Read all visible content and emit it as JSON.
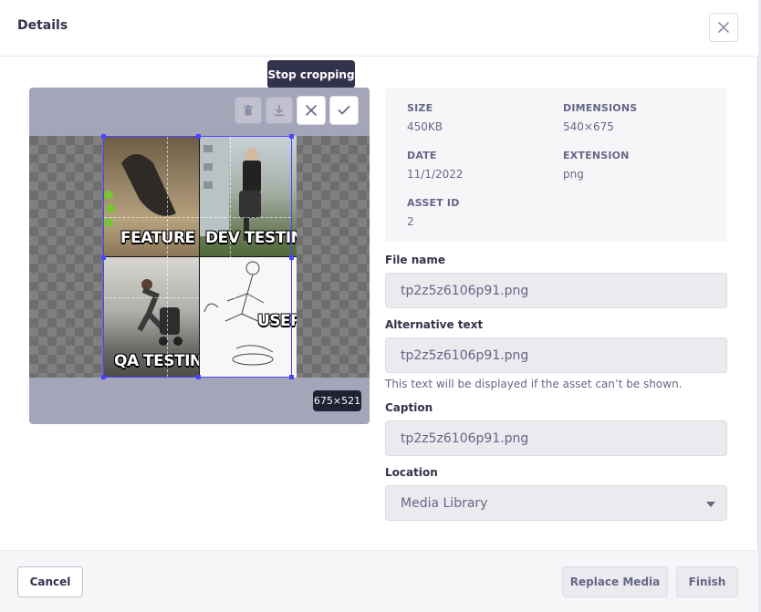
{
  "modal": {
    "title": "Details",
    "close_icon": "close-icon"
  },
  "tooltip": {
    "text": "Stop cropping"
  },
  "preview": {
    "toolbar": [
      {
        "name": "trash-icon",
        "enabled": false
      },
      {
        "name": "download-icon",
        "enabled": false
      },
      {
        "name": "close-icon",
        "enabled": true
      },
      {
        "name": "check-icon",
        "enabled": true
      }
    ],
    "image_labels": [
      "FEATURE",
      "DEV TESTING",
      "QA TESTING",
      "USER"
    ],
    "crop_size": "675×521"
  },
  "info": {
    "size_label": "SIZE",
    "size_value": "450KB",
    "dimensions_label": "DIMENSIONS",
    "dimensions_value": "540×675",
    "date_label": "DATE",
    "date_value": "11/1/2022",
    "extension_label": "EXTENSION",
    "extension_value": "png",
    "asset_id_label": "ASSET ID",
    "asset_id_value": "2"
  },
  "form": {
    "file_name_label": "File name",
    "file_name_value": "tp2z5z6106p91.png",
    "alt_text_label": "Alternative text",
    "alt_text_value": "tp2z5z6106p91.png",
    "alt_text_hint": "This text will be displayed if the asset can’t be shown.",
    "caption_label": "Caption",
    "caption_value": "tp2z5z6106p91.png",
    "location_label": "Location",
    "location_value": "Media Library"
  },
  "footer": {
    "cancel_label": "Cancel",
    "replace_label": "Replace Media",
    "finish_label": "Finish"
  },
  "colors": {
    "accent": "#4945ff",
    "tooltip_bg": "#32324d",
    "panel_bg": "#f6f6f9"
  }
}
